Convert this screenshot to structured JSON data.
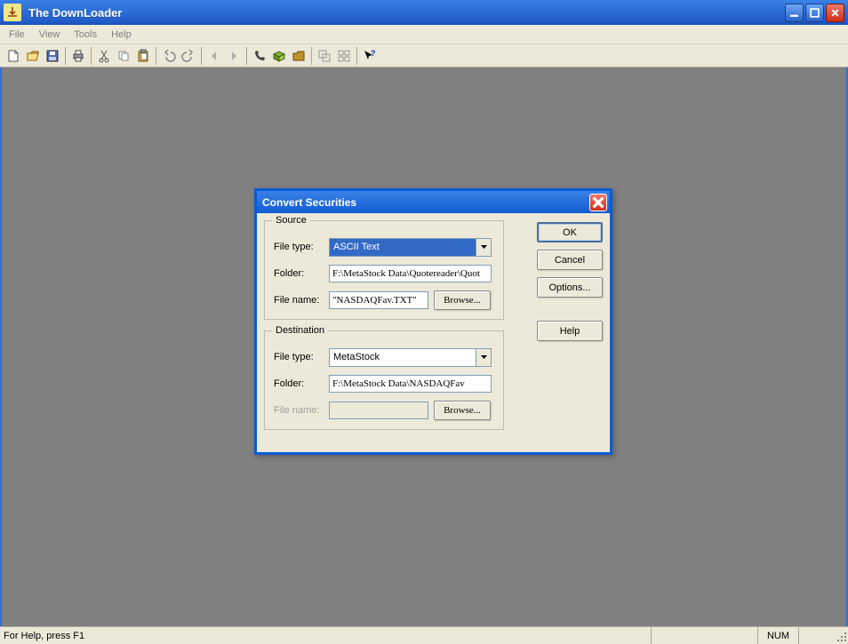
{
  "app": {
    "title": "The DownLoader"
  },
  "menu": {
    "file": "File",
    "view": "View",
    "tools": "Tools",
    "help": "Help"
  },
  "status": {
    "help_hint": "For Help, press F1",
    "num": "NUM"
  },
  "dialog": {
    "title": "Convert Securities",
    "source": {
      "legend": "Source",
      "file_type_label": "File type:",
      "file_type_value": "ASCII Text",
      "folder_label": "Folder:",
      "folder_value": "F:\\MetaStock Data\\Quotereader\\Quot",
      "file_name_label": "File name:",
      "file_name_value": "\"NASDAQFav.TXT\"",
      "browse": "Browse..."
    },
    "destination": {
      "legend": "Destination",
      "file_type_label": "File type:",
      "file_type_value": "MetaStock",
      "folder_label": "Folder:",
      "folder_value": "F:\\MetaStock Data\\NASDAQFav",
      "file_name_label": "File name:",
      "file_name_value": "",
      "browse": "Browse..."
    },
    "buttons": {
      "ok": "OK",
      "cancel": "Cancel",
      "options": "Options...",
      "help": "Help"
    }
  }
}
